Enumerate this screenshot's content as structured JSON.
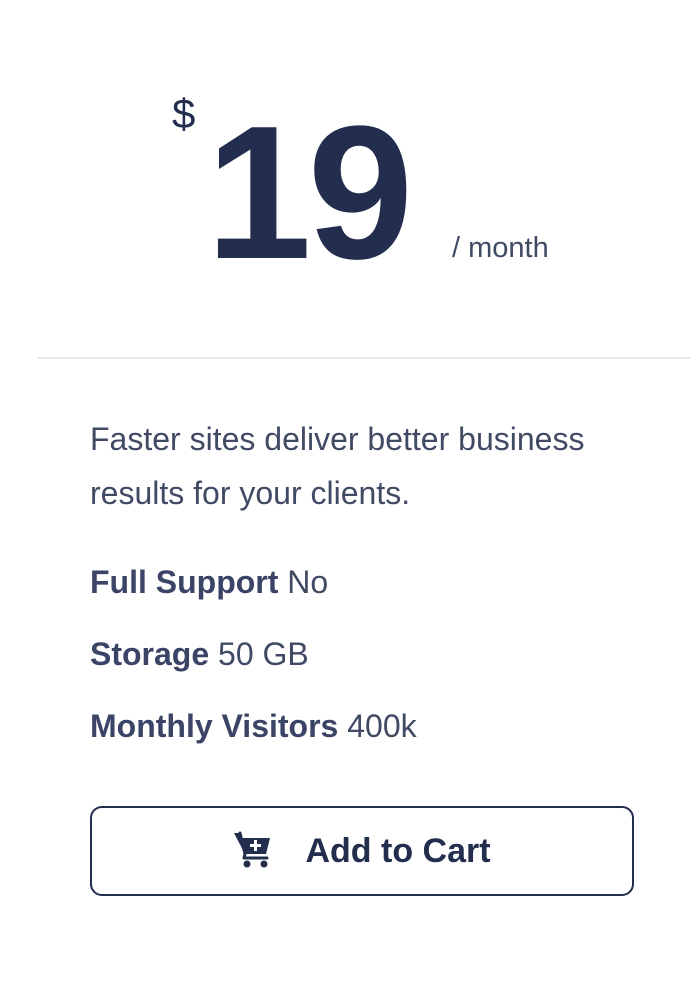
{
  "pricing": {
    "currency_symbol": "$",
    "amount": "19",
    "period": "/ month"
  },
  "description": "Faster sites deliver better business results for your clients.",
  "features": [
    {
      "name": "Full Support",
      "value": "No"
    },
    {
      "name": "Storage",
      "value": "50 GB"
    },
    {
      "name": "Monthly Visitors",
      "value": "400k"
    }
  ],
  "cart_button": {
    "label": "Add to Cart",
    "icon": "cart-plus-icon"
  },
  "colors": {
    "primary": "#232d4d",
    "text": "#414a64",
    "divider": "#e8e8ea"
  }
}
